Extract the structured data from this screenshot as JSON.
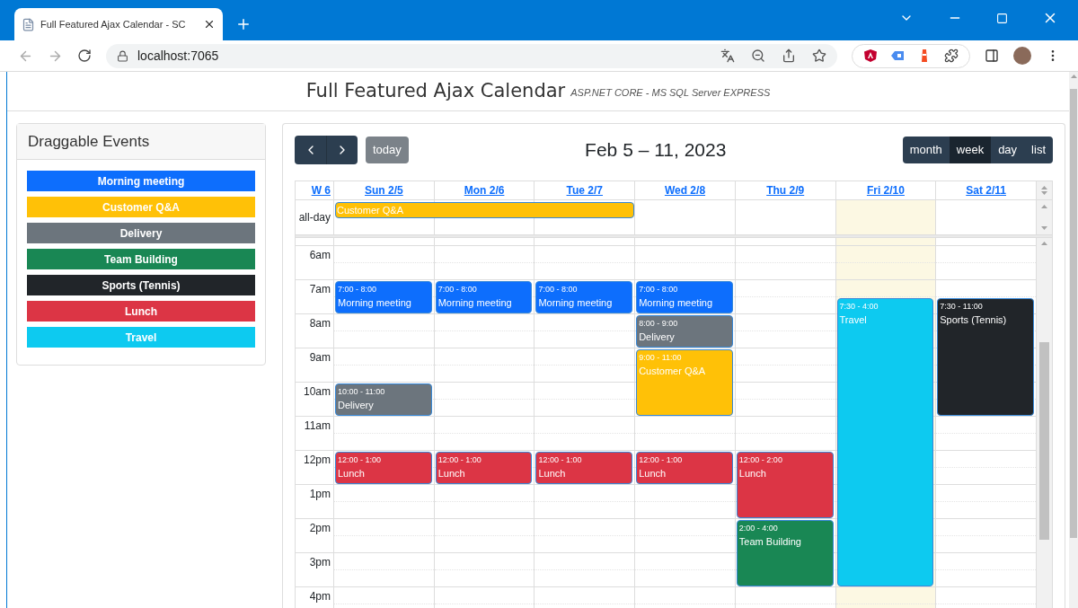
{
  "browser": {
    "tab_title": "Full Featured Ajax Calendar - SC",
    "url": "localhost:7065"
  },
  "page": {
    "title": "Full Featured Ajax Calendar",
    "subtitle": "ASP.NET CORE - MS SQL Server EXPRESS"
  },
  "draggable_events": {
    "title": "Draggable Events",
    "items": [
      {
        "label": "Morning meeting",
        "color": "#0d6efd"
      },
      {
        "label": "Customer Q&A",
        "color": "#ffc107"
      },
      {
        "label": "Delivery",
        "color": "#6c757d"
      },
      {
        "label": "Team Building",
        "color": "#198754"
      },
      {
        "label": "Sports (Tennis)",
        "color": "#212529"
      },
      {
        "label": "Lunch",
        "color": "#dc3545"
      },
      {
        "label": "Travel",
        "color": "#0dcaf0"
      }
    ]
  },
  "calendar": {
    "title": "Feb 5 – 11, 2023",
    "today_button": "today",
    "views": [
      {
        "label": "month",
        "selected": false
      },
      {
        "label": "week",
        "selected": true
      },
      {
        "label": "day",
        "selected": false
      },
      {
        "label": "list",
        "selected": false
      }
    ],
    "week_label": "W 6",
    "all_day_label": "all-day",
    "all_day_events": [
      {
        "title": "Customer Q&A",
        "color": "#ffc107"
      }
    ],
    "hours": [
      "6am",
      "7am",
      "8am",
      "9am",
      "10am",
      "11am",
      "12pm",
      "1pm",
      "2pm",
      "3pm",
      "4pm"
    ],
    "days": [
      {
        "label": "Sun 2/5",
        "today": false,
        "all_day_covered": true,
        "events": [
          {
            "time": "7:00 - 8:00",
            "title": "Morning meeting",
            "color": "#0d6efd"
          },
          {
            "time": "10:00 - 11:00",
            "title": "Delivery",
            "color": "#6c757d"
          },
          {
            "time": "12:00 - 1:00",
            "title": "Lunch",
            "color": "#dc3545"
          }
        ]
      },
      {
        "label": "Mon 2/6",
        "today": false,
        "all_day_covered": true,
        "events": [
          {
            "time": "7:00 - 8:00",
            "title": "Morning meeting",
            "color": "#0d6efd"
          },
          {
            "time": "12:00 - 1:00",
            "title": "Lunch",
            "color": "#dc3545"
          }
        ]
      },
      {
        "label": "Tue 2/7",
        "today": false,
        "all_day_covered": true,
        "events": [
          {
            "time": "7:00 - 8:00",
            "title": "Morning meeting",
            "color": "#0d6efd"
          },
          {
            "time": "12:00 - 1:00",
            "title": "Lunch",
            "color": "#dc3545"
          }
        ]
      },
      {
        "label": "Wed 2/8",
        "today": false,
        "all_day_covered": false,
        "events": [
          {
            "time": "7:00 - 8:00",
            "title": "Morning meeting",
            "color": "#0d6efd"
          },
          {
            "time": "8:00 - 9:00",
            "title": "Delivery",
            "color": "#6c757d"
          },
          {
            "time": "9:00 - 11:00",
            "title": "Customer Q&A",
            "color": "#ffc107"
          },
          {
            "time": "12:00 - 1:00",
            "title": "Lunch",
            "color": "#dc3545"
          }
        ]
      },
      {
        "label": "Thu 2/9",
        "today": false,
        "all_day_covered": false,
        "events": [
          {
            "time": "12:00 - 2:00",
            "title": "Lunch",
            "color": "#dc3545"
          },
          {
            "time": "2:00 - 4:00",
            "title": "Team Building",
            "color": "#198754"
          }
        ]
      },
      {
        "label": "Fri 2/10",
        "today": true,
        "all_day_covered": false,
        "events": [
          {
            "time": "7:30 - 4:00",
            "title": "Travel",
            "color": "#0dcaf0"
          }
        ]
      },
      {
        "label": "Sat 2/11",
        "today": false,
        "all_day_covered": false,
        "events": [
          {
            "time": "7:30 - 11:00",
            "title": "Sports (Tennis)",
            "color": "#212529"
          }
        ]
      }
    ]
  }
}
